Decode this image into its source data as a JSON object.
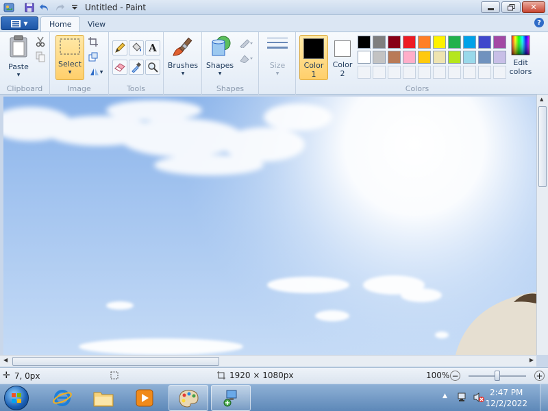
{
  "window": {
    "title": "Untitled - Paint",
    "minimize_icon": "minimize-icon",
    "maximize_icon": "restore-icon",
    "close_icon": "close-icon"
  },
  "tabs": [
    {
      "label": "Home",
      "active": true
    },
    {
      "label": "View",
      "active": false
    }
  ],
  "ribbon": {
    "clipboard": {
      "label": "Clipboard",
      "paste_label": "Paste"
    },
    "image": {
      "label": "Image",
      "select_label": "Select"
    },
    "tools": {
      "label": "Tools"
    },
    "brushes": {
      "label": "Brushes"
    },
    "shapes": {
      "label": "Shapes",
      "shapes_label": "Shapes"
    },
    "size": {
      "label": "Size"
    },
    "colors": {
      "label": "Colors",
      "color1_label": "Color",
      "color1_num": "1",
      "color2_label": "Color",
      "color2_num": "2",
      "edit_label": "Edit",
      "edit_label2": "colors",
      "color1_value": "#000000",
      "color2_value": "#ffffff",
      "palette_row1": [
        "#000000",
        "#7f7f7f",
        "#880015",
        "#ed1c24",
        "#ff7f27",
        "#fff200",
        "#22b14c",
        "#00a2e8",
        "#3f48cc",
        "#a349a4"
      ],
      "palette_row2": [
        "#ffffff",
        "#c3c3c3",
        "#b97a57",
        "#ffaec9",
        "#ffc90e",
        "#efe4b0",
        "#b5e61d",
        "#99d9ea",
        "#7092be",
        "#c8bfe7"
      ]
    }
  },
  "status": {
    "cursor_position": "7, 0px",
    "image_size": "1920 × 1080px",
    "zoom": "100%"
  },
  "taskbar": {
    "time": "2:47 PM",
    "date": "12/2/2022"
  }
}
